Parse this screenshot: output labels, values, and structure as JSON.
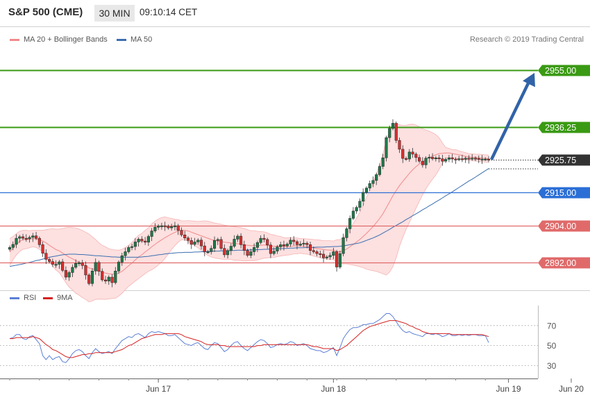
{
  "header": {
    "title": "S&P 500 (CME)",
    "timeframe": "30 MIN",
    "time": "09:10:14 CET"
  },
  "legend": {
    "bollinger_label": "MA 20 + Bollinger Bands",
    "ma50_label": "MA 50",
    "rsi_label": "RSI",
    "ma9_label": "9MA"
  },
  "copyright": "Research © 2019 Trading Central",
  "colors": {
    "green": "#3a9a13",
    "blue": "#2b6fd6",
    "red": "#e06a6a",
    "dark": "#333333",
    "band_fill": "#fde0e0",
    "candle": "#1f7a4a",
    "candle_down": "#d83030",
    "ma50": "#3b6eb0",
    "arrow": "#3163a8",
    "rsi": "#5b7fd6",
    "rsi_ma": "#d62020"
  },
  "chart_data": [
    {
      "type": "candlestick",
      "ylim": [
        2883,
        2962
      ],
      "x_tick_labels": [
        "Jun 17",
        "Jun 18",
        "Jun 19",
        "Jun 20"
      ],
      "x_tick_index": [
        45,
        98,
        151,
        170
      ],
      "levels": [
        {
          "value": 2955.0,
          "label": "2955.00",
          "kind": "resistance"
        },
        {
          "value": 2936.25,
          "label": "2936.25",
          "kind": "resistance"
        },
        {
          "value": 2925.75,
          "label": "2925.75",
          "kind": "last"
        },
        {
          "value": 2915.0,
          "label": "2915.00",
          "kind": "pivot"
        },
        {
          "value": 2904.0,
          "label": "2904.00",
          "kind": "support"
        },
        {
          "value": 2892.0,
          "label": "2892.00",
          "kind": "support"
        }
      ],
      "closes": [
        2897.0,
        2898.0,
        2900.0,
        2900.5,
        2900.0,
        2899.8,
        2900.3,
        2900.8,
        2900.0,
        2897.9,
        2895.1,
        2893.1,
        2892.4,
        2891.5,
        2891.5,
        2892.3,
        2889.5,
        2887.3,
        2888.8,
        2890.5,
        2891.8,
        2892.0,
        2891.1,
        2888.0,
        2885.2,
        2889.3,
        2892.1,
        2889.2,
        2886.4,
        2886.0,
        2887.3,
        2885.5,
        2889.3,
        2892.2,
        2894.3,
        2895.6,
        2897.0,
        2897.3,
        2898.8,
        2899.7,
        2899.1,
        2898.7,
        2900.6,
        2902.4,
        2903.6,
        2904.0,
        2904.1,
        2903.9,
        2903.4,
        2903.8,
        2904.1,
        2902.6,
        2901.1,
        2900.1,
        2899.3,
        2898.0,
        2898.8,
        2899.4,
        2897.5,
        2895.6,
        2895.6,
        2896.7,
        2899.3,
        2899.6,
        2896.7,
        2894.6,
        2896.0,
        2897.4,
        2899.7,
        2900.7,
        2897.9,
        2896.0,
        2894.4,
        2895.6,
        2897.0,
        2898.6,
        2900.0,
        2899.6,
        2897.8,
        2895.0,
        2895.8,
        2897.2,
        2897.9,
        2897.5,
        2898.1,
        2899.4,
        2898.9,
        2897.9,
        2898.1,
        2898.4,
        2897.9,
        2896.0,
        2895.6,
        2895.0,
        2894.8,
        2893.6,
        2893.9,
        2894.4,
        2895.6,
        2890.6,
        2895.0,
        2900.2,
        2903.1,
        2906.5,
        2908.9,
        2910.1,
        2912.1,
        2915.0,
        2916.4,
        2917.9,
        2918.9,
        2920.8,
        2923.5,
        2926.3,
        2932.9,
        2935.9,
        2937.6,
        2932.0,
        2929.1,
        2926.1,
        2925.9,
        2928.2,
        2927.5,
        2926.4,
        2925.2,
        2924.0,
        2926.2,
        2926.5,
        2926.0,
        2926.3,
        2926.0,
        2925.2,
        2925.8,
        2926.3,
        2925.9,
        2925.8,
        2926.0,
        2925.8,
        2926.2,
        2925.9,
        2926.2,
        2926.1,
        2925.8,
        2925.9,
        2925.9,
        2925.75
      ],
      "bb_mid": [
        2895.5,
        2896.8,
        2898.0,
        2899.0,
        2899.5,
        2899.6,
        2899.7,
        2899.9,
        2899.8,
        2899.5,
        2899.1,
        2898.5,
        2897.7,
        2897.0,
        2896.3,
        2895.9,
        2895.2,
        2894.5,
        2893.8,
        2893.3,
        2892.7,
        2892.2,
        2891.6,
        2891.0,
        2890.3,
        2890.0,
        2889.8,
        2889.3,
        2888.9,
        2888.6,
        2888.4,
        2888.3,
        2888.3,
        2888.6,
        2889.2,
        2890.1,
        2891.0,
        2891.9,
        2892.9,
        2893.9,
        2894.6,
        2895.5,
        2896.3,
        2897.2,
        2898.0,
        2898.8,
        2899.5,
        2900.2,
        2900.8,
        2901.4,
        2901.9,
        2902.4,
        2902.6,
        2902.6,
        2902.4,
        2902.0,
        2901.6,
        2901.2,
        2900.8,
        2900.4,
        2900.0,
        2899.6,
        2899.3,
        2899.1,
        2898.9,
        2898.7,
        2898.6,
        2898.5,
        2898.3,
        2898.2,
        2898.1,
        2897.9,
        2897.7,
        2897.6,
        2897.6,
        2897.6,
        2897.7,
        2897.8,
        2897.7,
        2897.5,
        2897.4,
        2897.4,
        2897.4,
        2897.3,
        2897.3,
        2897.4,
        2897.5,
        2897.5,
        2897.5,
        2897.4,
        2897.3,
        2897.1,
        2896.9,
        2896.7,
        2896.5,
        2896.3,
        2896.2,
        2896.1,
        2896.1,
        2895.7,
        2895.6,
        2895.9,
        2896.5,
        2897.2,
        2898.0,
        2898.8,
        2899.6,
        2900.6,
        2901.6,
        2902.7,
        2903.8,
        2905.1,
        2906.5,
        2908.0,
        2910.0,
        2911.9,
        2913.9,
        2915.6,
        2917.2,
        2918.6,
        2919.9,
        2921.2,
        2922.4,
        2923.4,
        2924.3,
        2925.0,
        2925.8,
        2926.4,
        2926.9,
        2927.3,
        2927.7,
        2927.8,
        2927.9,
        2927.9,
        2927.7,
        2927.5,
        2927.3,
        2927.1,
        2926.8,
        2926.6,
        2926.5,
        2926.4,
        2926.3,
        2926.2,
        2926.1,
        2926.0
      ],
      "bb_upper": [
        2899.9,
        2900.6,
        2901.5,
        2902.3,
        2902.6,
        2902.6,
        2902.5,
        2902.6,
        2902.6,
        2902.6,
        2902.6,
        2902.8,
        2903.0,
        2903.1,
        2903.0,
        2903.0,
        2903.2,
        2903.5,
        2903.6,
        2903.5,
        2903.4,
        2903.0,
        2902.6,
        2902.0,
        2901.4,
        2900.5,
        2899.6,
        2898.5,
        2897.7,
        2897.2,
        2896.6,
        2896.3,
        2896.2,
        2896.1,
        2896.4,
        2897.0,
        2897.7,
        2898.7,
        2899.8,
        2901.0,
        2901.6,
        2902.6,
        2903.4,
        2904.7,
        2905.6,
        2906.3,
        2906.8,
        2907.0,
        2906.7,
        2906.5,
        2906.2,
        2906.1,
        2905.7,
        2905.7,
        2905.8,
        2905.7,
        2905.6,
        2905.5,
        2905.6,
        2905.7,
        2905.6,
        2905.3,
        2905.0,
        2904.8,
        2904.6,
        2904.3,
        2904.1,
        2903.9,
        2903.8,
        2903.6,
        2903.5,
        2903.2,
        2902.8,
        2902.5,
        2902.5,
        2902.3,
        2902.2,
        2902.1,
        2901.8,
        2901.3,
        2901.1,
        2900.8,
        2900.6,
        2900.2,
        2900.1,
        2900.2,
        2900.1,
        2900.1,
        2899.9,
        2899.9,
        2899.8,
        2899.7,
        2899.6,
        2899.5,
        2899.4,
        2899.2,
        2899.2,
        2899.2,
        2899.1,
        2899.5,
        2899.6,
        2900.2,
        2901.4,
        2903.0,
        2904.8,
        2906.6,
        2908.5,
        2910.8,
        2913.3,
        2915.8,
        2918.2,
        2921.0,
        2924.2,
        2927.6,
        2932.0,
        2934.9,
        2937.1,
        2937.6,
        2937.1,
        2936.9,
        2936.9,
        2937.2,
        2937.3,
        2937.0,
        2936.5,
        2935.8,
        2935.4,
        2935.0,
        2934.5,
        2933.9,
        2932.9,
        2931.2,
        2929.7,
        2929.4,
        2929.0,
        2929.0,
        2928.6,
        2928.3,
        2928.0,
        2927.7,
        2927.6,
        2927.5,
        2927.5,
        2927.4,
        2927.3,
        2927.2
      ],
      "bb_lower": [
        2891.1,
        2893.0,
        2894.5,
        2895.7,
        2896.4,
        2896.6,
        2896.9,
        2897.2,
        2897.0,
        2896.4,
        2895.6,
        2894.2,
        2892.4,
        2890.9,
        2889.6,
        2888.8,
        2887.2,
        2885.5,
        2884.0,
        2883.1,
        2882.0,
        2881.4,
        2880.6,
        2880.0,
        2879.2,
        2879.5,
        2880.0,
        2880.1,
        2880.1,
        2880.0,
        2880.2,
        2880.3,
        2880.4,
        2881.1,
        2882.0,
        2883.2,
        2884.3,
        2885.1,
        2886.0,
        2886.8,
        2887.6,
        2888.4,
        2889.2,
        2889.7,
        2890.4,
        2891.3,
        2892.2,
        2893.4,
        2894.9,
        2896.3,
        2897.6,
        2898.7,
        2899.5,
        2899.5,
        2899.0,
        2898.3,
        2897.6,
        2896.9,
        2896.0,
        2895.1,
        2894.4,
        2893.9,
        2893.6,
        2893.4,
        2893.2,
        2893.1,
        2893.1,
        2893.1,
        2892.8,
        2892.8,
        2892.7,
        2892.6,
        2892.6,
        2892.7,
        2892.7,
        2892.9,
        2893.2,
        2893.5,
        2893.6,
        2893.7,
        2893.7,
        2894.0,
        2894.2,
        2894.4,
        2894.5,
        2894.6,
        2894.9,
        2894.9,
        2895.1,
        2894.9,
        2894.8,
        2894.5,
        2894.2,
        2893.9,
        2893.6,
        2893.4,
        2893.2,
        2893.0,
        2893.1,
        2891.9,
        2891.6,
        2891.6,
        2891.6,
        2891.4,
        2891.2,
        2891.0,
        2890.7,
        2890.4,
        2889.9,
        2889.6,
        2889.4,
        2889.2,
        2888.8,
        2888.4,
        2888.0,
        2888.9,
        2890.7,
        2893.6,
        2897.3,
        2900.3,
        2902.9,
        2905.2,
        2907.5,
        2909.8,
        2912.1,
        2914.2,
        2916.2,
        2917.8,
        2919.3,
        2920.7,
        2922.5,
        2924.4,
        2926.1,
        2926.4,
        2926.4,
        2926.0,
        2926.0,
        2925.9,
        2925.6,
        2925.5,
        2925.4,
        2925.3,
        2925.1,
        2925.0,
        2924.9,
        2924.8
      ],
      "ma50": [
        2890.8,
        2891.0,
        2891.2,
        2891.4,
        2891.6,
        2891.9,
        2892.1,
        2892.4,
        2892.7,
        2892.9,
        2893.2,
        2893.5,
        2893.8,
        2894.0,
        2894.2,
        2894.4,
        2894.6,
        2894.7,
        2894.8,
        2894.8,
        2894.8,
        2894.7,
        2894.7,
        2894.6,
        2894.5,
        2894.4,
        2894.3,
        2894.3,
        2894.2,
        2894.1,
        2894.0,
        2893.9,
        2893.9,
        2893.8,
        2893.8,
        2893.8,
        2893.8,
        2893.8,
        2893.8,
        2893.8,
        2893.9,
        2894.0,
        2894.1,
        2894.3,
        2894.4,
        2894.6,
        2894.7,
        2894.9,
        2895.0,
        2895.1,
        2895.2,
        2895.3,
        2895.3,
        2895.4,
        2895.4,
        2895.4,
        2895.5,
        2895.5,
        2895.6,
        2895.6,
        2895.7,
        2895.7,
        2895.8,
        2895.8,
        2895.9,
        2895.9,
        2895.9,
        2896.0,
        2896.0,
        2896.1,
        2896.1,
        2896.1,
        2896.2,
        2896.2,
        2896.2,
        2896.3,
        2896.3,
        2896.4,
        2896.4,
        2896.5,
        2896.5,
        2896.6,
        2896.6,
        2896.7,
        2896.7,
        2896.8,
        2896.8,
        2896.9,
        2896.9,
        2896.9,
        2897.0,
        2897.0,
        2897.0,
        2897.1,
        2897.1,
        2897.1,
        2897.2,
        2897.2,
        2897.3,
        2897.3,
        2897.4,
        2897.5,
        2897.7,
        2897.9,
        2898.1,
        2898.3,
        2898.5,
        2898.9,
        2899.3,
        2899.7,
        2900.1,
        2900.6,
        2901.1,
        2901.7,
        2902.3,
        2902.9,
        2903.6,
        2904.2,
        2904.8,
        2905.4,
        2906.1,
        2906.7,
        2907.4,
        2908.0,
        2908.6,
        2909.3,
        2909.9,
        2910.6,
        2911.2,
        2911.9,
        2912.5,
        2913.2,
        2913.9,
        2914.5,
        2915.2,
        2915.9,
        2916.6,
        2917.3,
        2918.0,
        2918.7,
        2919.3,
        2920.0,
        2920.7,
        2921.4,
        2922.1,
        2922.8
      ],
      "projection": {
        "from": 2925.75,
        "to": 2955.0
      }
    },
    {
      "type": "line",
      "title": "RSI",
      "ylim": [
        22,
        90
      ],
      "y_ticks": [
        30,
        50,
        70
      ],
      "series": [
        {
          "name": "RSI",
          "values": [
            57,
            58,
            61,
            61,
            57,
            56,
            59,
            60,
            56,
            52,
            40,
            36,
            40,
            36,
            38,
            39,
            34,
            33,
            37,
            42,
            45,
            46,
            44,
            40,
            37,
            43,
            47,
            44,
            42,
            43,
            44,
            42,
            47,
            51,
            55,
            57,
            59,
            58,
            61,
            62,
            60,
            58,
            62,
            64,
            63,
            64,
            63,
            62,
            60,
            60,
            61,
            58,
            55,
            52,
            51,
            50,
            52,
            53,
            50,
            47,
            46,
            50,
            53,
            52,
            48,
            44,
            46,
            50,
            53,
            54,
            50,
            47,
            45,
            48,
            51,
            54,
            56,
            55,
            52,
            48,
            49,
            51,
            52,
            51,
            52,
            54,
            53,
            50,
            51,
            52,
            50,
            47,
            46,
            45,
            45,
            43,
            44,
            46,
            48,
            40,
            48,
            57,
            62,
            66,
            68,
            68,
            69,
            71,
            71,
            72,
            72,
            74,
            76,
            79,
            82,
            82,
            79,
            74,
            69,
            65,
            63,
            64,
            62,
            61,
            60,
            59,
            62,
            62,
            61,
            62,
            61,
            59,
            60,
            62,
            60,
            60,
            61,
            60,
            61,
            60,
            61,
            61,
            60,
            60,
            60,
            53
          ]
        },
        {
          "name": "9MA",
          "values": [
            57,
            57,
            58,
            58,
            58,
            58,
            58,
            59,
            58,
            57,
            54,
            51,
            49,
            46,
            45,
            43,
            41,
            39,
            38,
            38,
            39,
            40,
            41,
            41,
            42,
            42,
            43,
            43,
            43,
            43,
            43,
            43,
            44,
            45,
            46,
            48,
            50,
            51,
            53,
            55,
            57,
            58,
            59,
            60,
            61,
            61,
            61,
            62,
            62,
            62,
            62,
            62,
            61,
            59,
            58,
            57,
            56,
            55,
            54,
            52,
            51,
            51,
            51,
            51,
            50,
            50,
            49,
            49,
            49,
            49,
            49,
            49,
            49,
            49,
            49,
            50,
            50,
            51,
            51,
            51,
            51,
            51,
            51,
            51,
            51,
            51,
            51,
            51,
            51,
            51,
            51,
            50,
            49,
            49,
            48,
            47,
            47,
            47,
            47,
            45,
            46,
            48,
            50,
            53,
            56,
            59,
            62,
            65,
            67,
            69,
            70,
            71,
            72,
            73,
            74,
            75,
            75,
            75,
            74,
            73,
            72,
            70,
            69,
            67,
            66,
            64,
            63,
            62,
            62,
            62,
            62,
            62,
            62,
            62,
            61,
            61,
            61,
            61,
            61,
            61,
            61,
            61,
            61,
            61,
            60,
            59
          ]
        }
      ]
    }
  ]
}
